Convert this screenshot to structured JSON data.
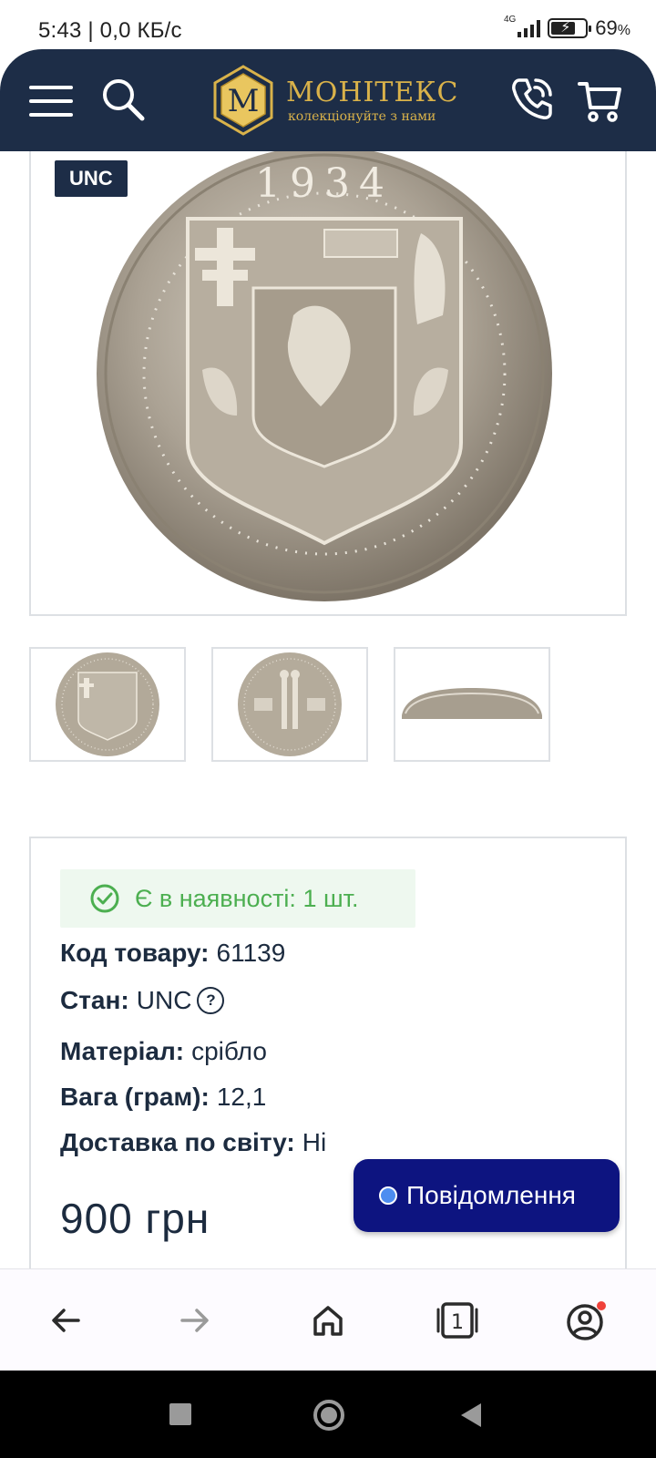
{
  "status_bar": {
    "time_net": "5:43 | 0,0 КБ/с",
    "network": "4G",
    "battery": "69",
    "battery_unit": "%"
  },
  "header": {
    "logo_letter": "M",
    "logo_name": "МОНІТЕКС",
    "logo_tagline": "колекціонуйте з нами",
    "icons": [
      "menu-icon",
      "search-icon",
      "phone-icon",
      "cart-icon"
    ],
    "colors": {
      "bg": "#1d2d47",
      "gold": "#d9b24a"
    }
  },
  "product": {
    "condition_badge": "UNC",
    "coin_legend_year": "1934",
    "thumbnails": [
      "obverse",
      "reverse",
      "edge"
    ],
    "stock_text": "Є в наявності: 1 шт.",
    "details": [
      {
        "label": "Код товару:",
        "value": "61139"
      },
      {
        "label": "Стан:",
        "value": "UNC"
      },
      {
        "label": "Матеріал:",
        "value": "срібло"
      },
      {
        "label": "Вага (грам):",
        "value": "12,1"
      },
      {
        "label": "Доставка по світу:",
        "value": "Ні"
      }
    ],
    "help_symbol": "?",
    "price": "900 грн"
  },
  "chat": {
    "label": "Повідомлення"
  },
  "browser_nav": {
    "icons": [
      "back-arrow-icon",
      "forward-arrow-icon",
      "home-icon",
      "tabs-icon",
      "account-icon"
    ],
    "tab_count": "1"
  }
}
